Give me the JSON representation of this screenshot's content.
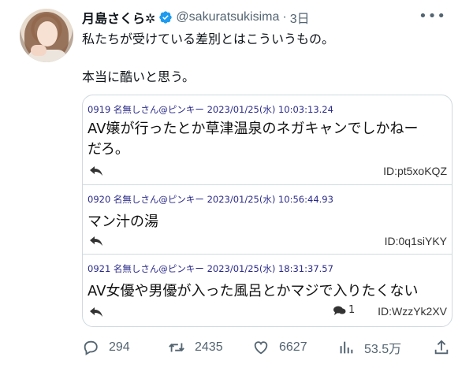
{
  "tweet": {
    "display_name": "月島さくら✲",
    "handle": "@sakuratsukisima",
    "separator": "·",
    "time": "3日",
    "text_lines": [
      "私たちが受けている差別とはこういうもの。",
      "本当に酷いと思う。"
    ]
  },
  "embedded_posts": [
    {
      "meta": "0919 名無しさん@ピンキー 2023/01/25(水) 10:03:13.24",
      "body_lines": [
        "AV嬢が行ったとか草津温泉のネガキャンでしかねー",
        "だろ。"
      ],
      "id": "ID:pt5xoKQZ"
    },
    {
      "meta": "0920 名無しさん@ピンキー 2023/01/25(水) 10:56:44.93",
      "body_lines": [
        "マン汁の湯"
      ],
      "id": "ID:0q1siYKY"
    },
    {
      "meta": "0921 名無しさん@ピンキー 2023/01/25(水) 18:31:37.57",
      "body_lines": [
        "AV女優や男優が入った風呂とかマジで入りたくない"
      ],
      "reply_count": "1",
      "id": "ID:WzzYk2XV"
    }
  ],
  "actions": {
    "replies": "294",
    "retweets": "2435",
    "likes": "6627",
    "views": "53.5万"
  },
  "colors": {
    "verified": "#1d9bf0",
    "muted": "#536471",
    "meta": "#2a2a8a"
  }
}
